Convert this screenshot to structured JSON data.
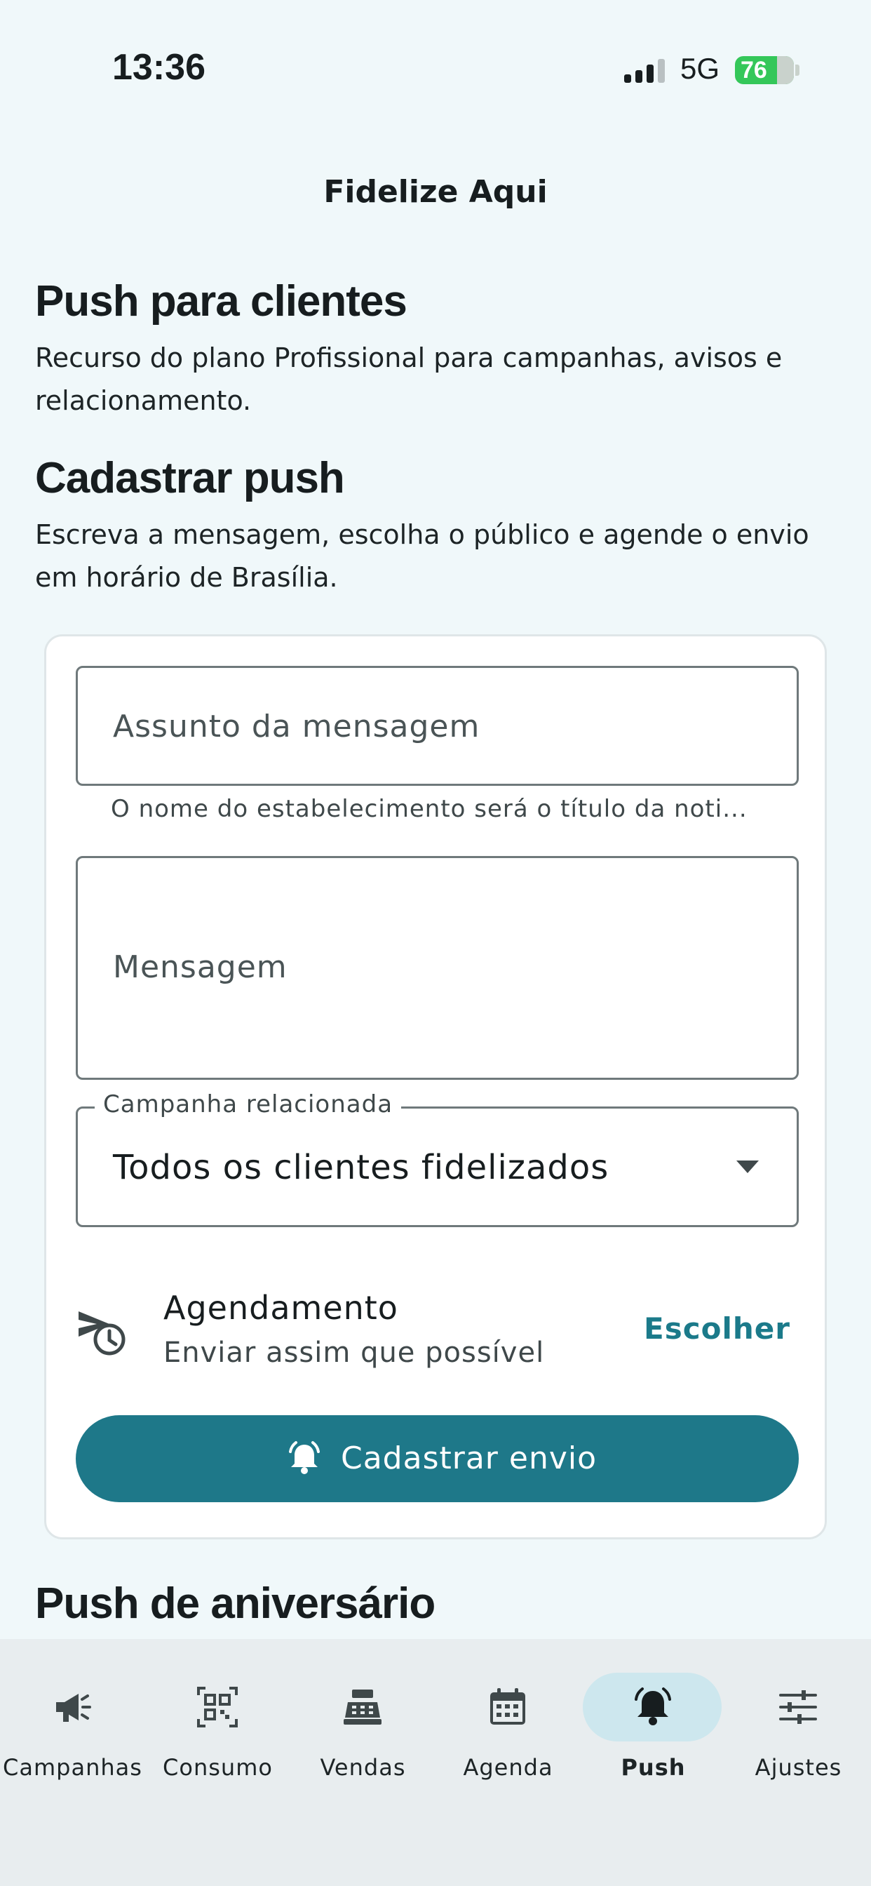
{
  "status_bar": {
    "time": "13:36",
    "network": "5G",
    "battery": "76"
  },
  "app": {
    "title": "Fidelize Aqui"
  },
  "push_section": {
    "title": "Push para clientes",
    "description": "Recurso do plano Profissional para campanhas, avisos e relacionamento."
  },
  "register_section": {
    "title": "Cadastrar push",
    "description": "Escreva a mensagem, escolha o público e agende o envio em horário de Brasília."
  },
  "form": {
    "subject_placeholder": "Assunto da mensagem",
    "subject_helper": "O nome do estabelecimento será o título da noti...",
    "message_placeholder": "Mensagem",
    "campaign_label": "Campanha relacionada",
    "campaign_value": "Todos os clientes fidelizados",
    "schedule_title": "Agendamento",
    "schedule_value": "Enviar assim que possível",
    "schedule_action": "Escolher",
    "submit_label": "Cadastrar envio"
  },
  "birthday_section": {
    "title": "Push de aniversário"
  },
  "nav": {
    "items": [
      {
        "label": "Campanhas",
        "icon": "megaphone-icon"
      },
      {
        "label": "Consumo",
        "icon": "qr-code-icon"
      },
      {
        "label": "Vendas",
        "icon": "cash-register-icon"
      },
      {
        "label": "Agenda",
        "icon": "calendar-icon"
      },
      {
        "label": "Push",
        "icon": "bell-icon",
        "active": true
      },
      {
        "label": "Ajustes",
        "icon": "sliders-icon"
      }
    ]
  },
  "colors": {
    "background": "#f0f8fa",
    "primary": "#1e7889",
    "accent_text": "#1b7a8a",
    "nav_active": "#cde7ee",
    "battery": "#34c759"
  }
}
